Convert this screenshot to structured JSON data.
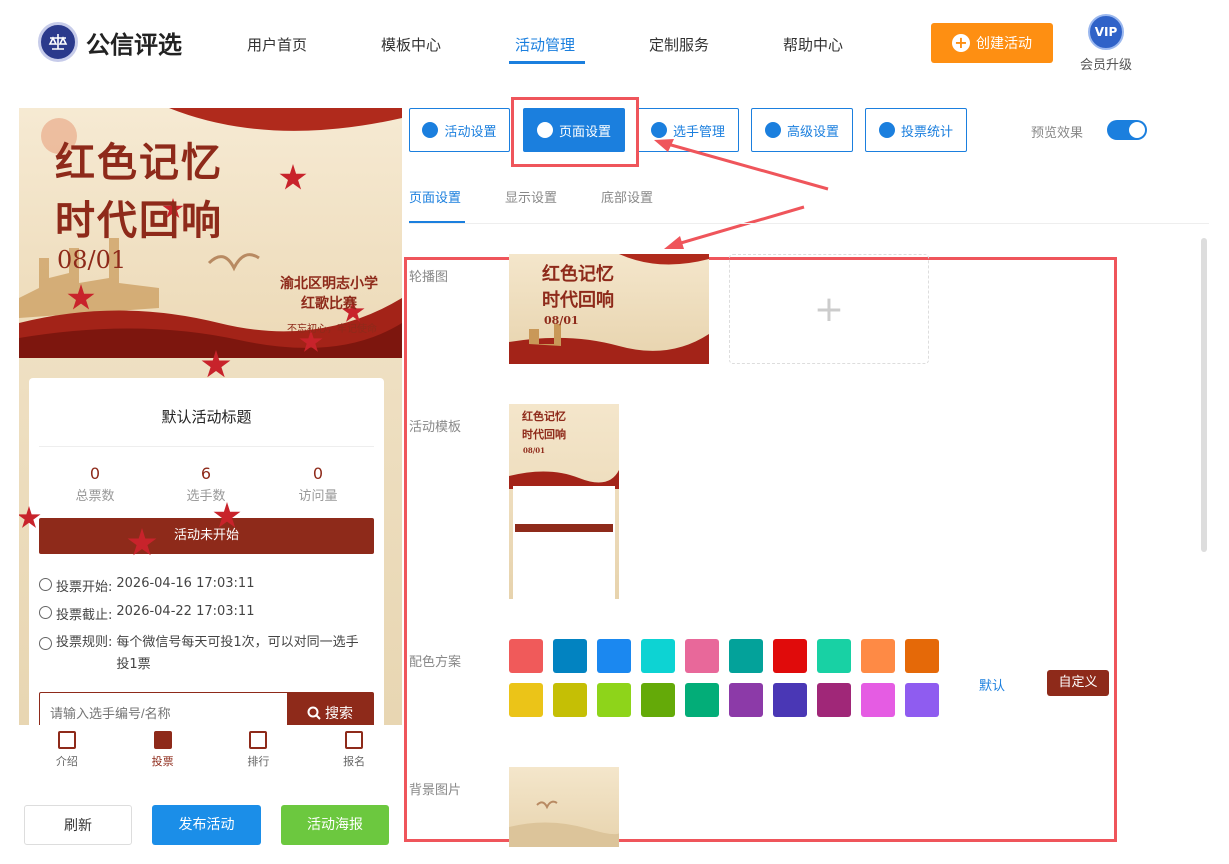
{
  "header": {
    "logo_text": "公信评选",
    "nav": [
      "用户首页",
      "模板中心",
      "活动管理",
      "定制服务",
      "帮助中心"
    ],
    "create_label": "创建活动",
    "vip_badge": "VIP",
    "vip_label": "会员升级"
  },
  "phone": {
    "banner_title_1": "红色记忆",
    "banner_title_2": "时代回响",
    "banner_date": "08/01",
    "banner_school_1": "渝北区明志小学",
    "banner_school_2": "红歌比赛",
    "banner_slogan": "不忘初心，牢记使命",
    "card_title": "默认活动标题",
    "stats": [
      {
        "num": "0",
        "label": "总票数"
      },
      {
        "num": "6",
        "label": "选手数"
      },
      {
        "num": "0",
        "label": "访问量"
      }
    ],
    "status": "活动未开始",
    "vote_start_label": "投票开始:",
    "vote_start": "2026-04-16 17:03:11",
    "vote_end_label": "投票截止:",
    "vote_end": "2026-04-22 17:03:11",
    "vote_rule_label": "投票规则:",
    "vote_rule": "每个微信号每天可投1次，可以对同一选手投1票",
    "search_placeholder": "请输入选手编号/名称",
    "search_button": "搜索",
    "tabs": [
      "介绍",
      "投票",
      "排行",
      "报名"
    ]
  },
  "bottom_buttons": {
    "refresh": "刷新",
    "publish": "发布活动",
    "poster": "活动海报"
  },
  "toolbar": {
    "tools": [
      "活动设置",
      "页面设置",
      "选手管理",
      "高级设置",
      "投票统计"
    ],
    "preview_label": "预览效果",
    "preview_on": true
  },
  "subtabs": [
    "页面设置",
    "显示设置",
    "底部设置"
  ],
  "settings": {
    "carousel_label": "轮播图",
    "carousel_thumb_title_1": "红色记忆",
    "carousel_thumb_title_2": "时代回响",
    "carousel_thumb_date": "08/01",
    "carousel_add": "+",
    "template_label": "活动模板",
    "template_thumb_title_1": "红色记忆",
    "template_thumb_title_2": "时代回响",
    "template_thumb_date": "08/01",
    "color_scheme_label": "配色方案",
    "colors_row1": [
      "#f05a5a",
      "#0283c1",
      "#1b88f0",
      "#0dd3d3",
      "#e8689a",
      "#03a29a",
      "#e00b0b",
      "#18d1a4",
      "#fe8a45",
      "#e56908"
    ],
    "colors_row2": [
      "#ebc418",
      "#c5bf05",
      "#8ed41a",
      "#64aa08",
      "#03ad78",
      "#8c3aa8",
      "#4a37b5",
      "#a02778",
      "#e55ce3",
      "#8f5cf0"
    ],
    "scheme_default": "默认",
    "scheme_custom": "自定义",
    "bg_label": "背景图片"
  }
}
